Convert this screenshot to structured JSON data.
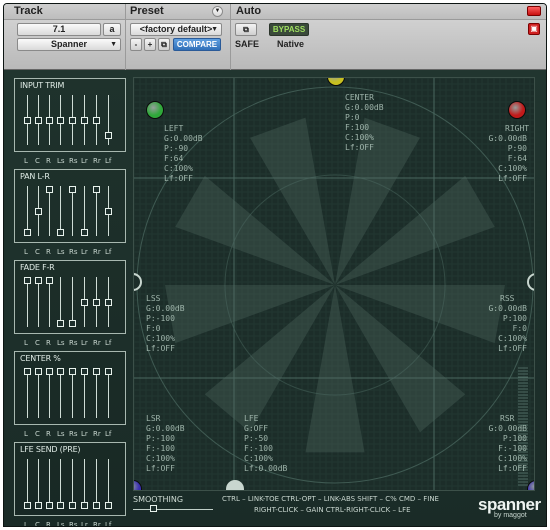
{
  "header": {
    "track_label": "Track",
    "preset_label": "Preset",
    "auto_label": "Auto",
    "track_format": "7.1",
    "track_channel": "a",
    "plugin_name": "Spanner",
    "preset_name": "<factory default>",
    "minus": "-",
    "plus": "+",
    "compare": "COMPARE",
    "bypass": "BYPASS",
    "safe": "SAFE",
    "native": "Native"
  },
  "channels": [
    "L",
    "C",
    "R",
    "Ls",
    "Rs",
    "Lr",
    "Rr",
    "Lf"
  ],
  "panels": [
    {
      "title": "INPUT TRIM",
      "levels": [
        0.5,
        0.5,
        0.5,
        0.5,
        0.5,
        0.5,
        0.5,
        0.15
      ]
    },
    {
      "title": "PAN L-R",
      "levels": [
        0.0,
        0.5,
        1.0,
        0.0,
        1.0,
        0.0,
        1.0,
        0.5
      ]
    },
    {
      "title": "FADE F-R",
      "levels": [
        1.0,
        1.0,
        1.0,
        0.0,
        0.0,
        0.5,
        0.5,
        0.5
      ]
    },
    {
      "title": "CENTER %",
      "levels": [
        1.0,
        1.0,
        1.0,
        1.0,
        1.0,
        1.0,
        1.0,
        1.0
      ]
    },
    {
      "title": "LFE SEND (PRE)",
      "levels": [
        0.0,
        0.0,
        0.0,
        0.0,
        0.0,
        0.0,
        0.0,
        0.0
      ]
    }
  ],
  "speakers": [
    {
      "name": "LEFT",
      "params": "G:0.00dB\nP:-90\nF:64\nC:100%\nLf:OFF"
    },
    {
      "name": "CENTER",
      "params": "G:0.00dB\nP:0\nF:100\nC:100%\nLf:OFF"
    },
    {
      "name": "RIGHT",
      "params": "G:0.00dB\nP:90\nF:64\nC:100%\nLf:OFF"
    },
    {
      "name": "LSS",
      "params": "G:0.00dB\nP:-100\nF:0\nC:100%\nLf:OFF"
    },
    {
      "name": "RSS",
      "params": "G:0.00dB\nP:100\nF:0\nC:100%\nLf:OFF"
    },
    {
      "name": "LSR",
      "params": "G:0.00dB\nP:-100\nF:-100\nC:100%\nLf:OFF"
    },
    {
      "name": "LFE",
      "params": "G:OFF\nP:-50\nF:-100\nC:100%\nLf:0.00dB"
    },
    {
      "name": "RSR",
      "params": "G:0.00dB\nP:100\nF:-100\nC:100%\nLf:OFF"
    }
  ],
  "colors": {
    "led_left": "#2fa83a",
    "led_right": "#c21a1a",
    "led_center": "#c8c020",
    "led_rear": "#3a2fb0"
  },
  "footer": {
    "smoothing": "SMOOTHING",
    "hint1": "CTRL – LINK-TOE   CTRL-OPT – LINK-ABS   SHIFT – C%   CMD – FINE",
    "hint2": "RIGHT-CLICK – GAIN   CTRL-RIGHT-CLICK – LFE",
    "logo": "spanner",
    "logo_sub": "by maggot"
  }
}
